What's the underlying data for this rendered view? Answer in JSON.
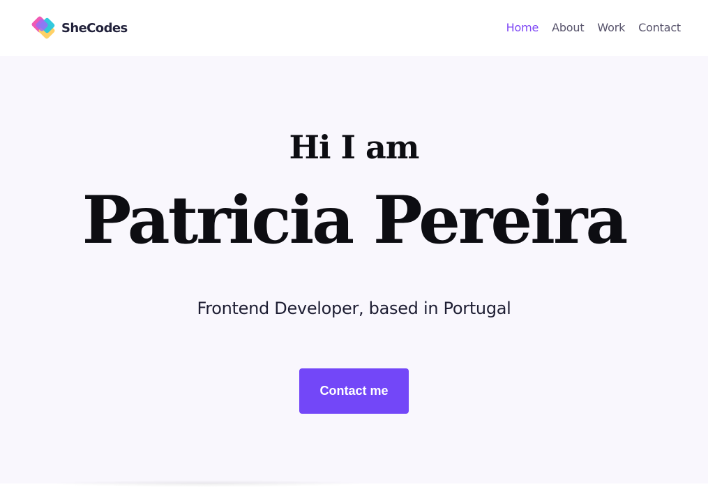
{
  "brand": {
    "name": "SheCodes",
    "icon": "shecodes-logo-icon",
    "colors": [
      "#f05ab4",
      "#9b6cf7",
      "#27c6dc",
      "#ffd166"
    ]
  },
  "nav": {
    "items": [
      {
        "label": "Home",
        "active": true
      },
      {
        "label": "About",
        "active": false
      },
      {
        "label": "Work",
        "active": false
      },
      {
        "label": "Contact",
        "active": false
      }
    ],
    "active_color": "#7d46f5",
    "color": "#57536b"
  },
  "hero": {
    "greeting": "Hi I am",
    "name": "Patricia Pereira",
    "subtitle": "Frontend Developer, based in Portugal",
    "cta_label": "Contact me",
    "background": "#f9f7fd",
    "accent": "#7347f8"
  }
}
